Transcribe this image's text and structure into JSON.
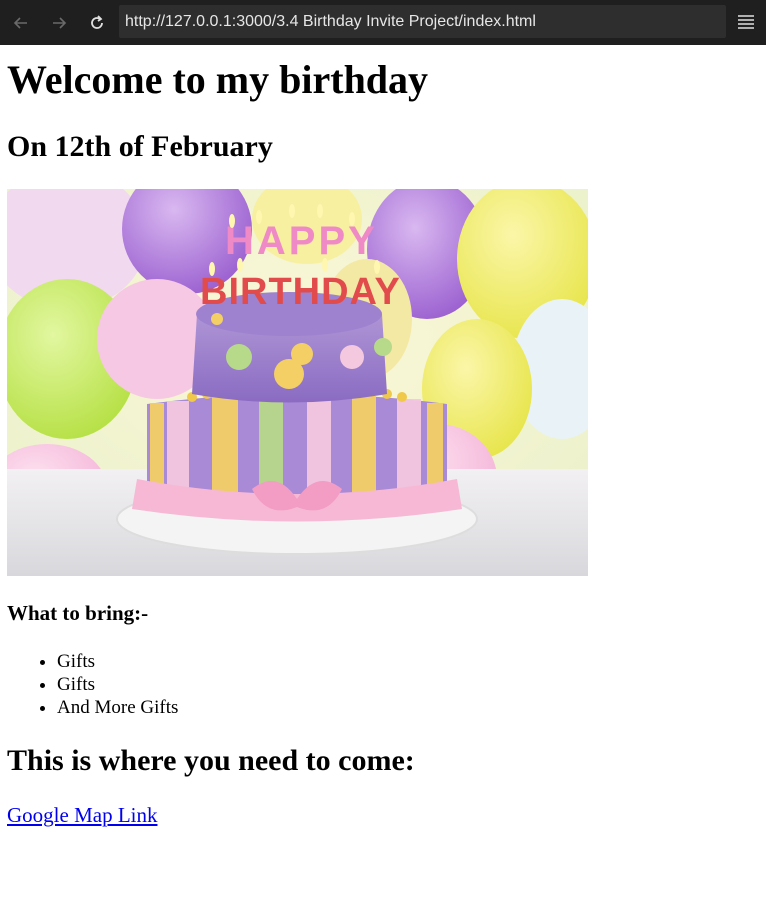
{
  "browser": {
    "url": "http://127.0.0.1:3000/3.4 Birthday Invite Project/index.html"
  },
  "page": {
    "heading": "Welcome to my birthday",
    "date": "On 12th of February",
    "image_alt": "birthday-cake",
    "bring_heading": "What to bring:-",
    "bring_items": [
      "Gifts",
      "Gifts",
      "And More Gifts"
    ],
    "where_heading": "This is where you need to come:",
    "map_link": "Google Map Link"
  },
  "cake_banner": {
    "line1": "HAPPY",
    "line2": "BIRTHDAY"
  },
  "colors": {
    "toolbar": "#1f1f1f",
    "url_bar": "#2e2e2e",
    "link": "#0000ee"
  }
}
